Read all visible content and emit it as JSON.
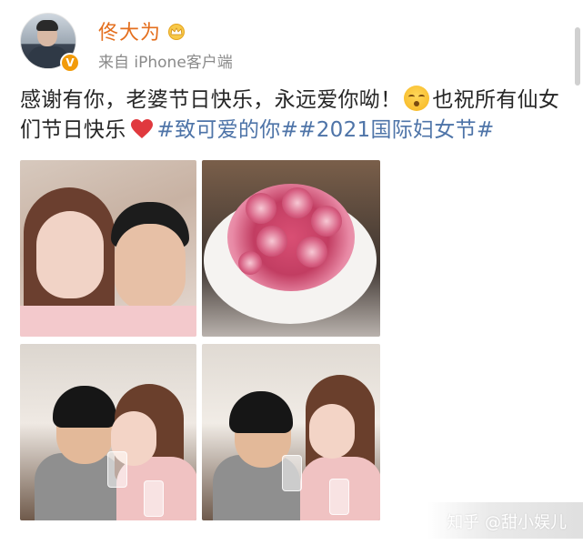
{
  "post": {
    "username": "佟大为",
    "source": "来自 iPhone客户端",
    "text_part1": "感谢有你，老婆节日快乐，永远爱你呦！",
    "text_part2": "也祝所有仙女们节日快乐",
    "hashtags": "#致可爱的你##2021国际妇女节#",
    "emoji_icon": "smiling-face-icon",
    "heart_icon": "red-heart-icon",
    "crown_icon": "crown-icon",
    "verified_badge": "V"
  },
  "colors": {
    "username": "#e46f1e",
    "hashtag": "#4e74a8",
    "verified": "#f29b0a",
    "heart": "#e0393e"
  },
  "photos": [
    {
      "name": "couple-selfie-kiss-cheek"
    },
    {
      "name": "floral-cake"
    },
    {
      "name": "couple-kiss-with-drinks"
    },
    {
      "name": "couple-toast-drinks"
    }
  ],
  "watermark": "知乎 @甜小娱儿"
}
